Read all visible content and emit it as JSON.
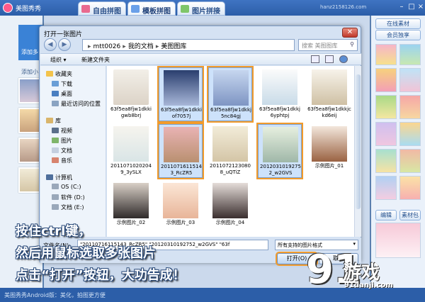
{
  "app": {
    "title": "美图秀秀",
    "url": "hanz2158126.com",
    "tabs": [
      "自由拼图",
      "模板拼图",
      "图片拼接"
    ]
  },
  "left_panel": {
    "add_background": "添加多",
    "add_image": "添加小"
  },
  "right_panel": {
    "online_material": "在线素材",
    "vip": "会员独享",
    "edit": "编辑",
    "material": "素材包"
  },
  "status_bar": "美图秀秀Android版：美化，拍图更方便",
  "dialog": {
    "title": "打开一张图片",
    "close": "✕",
    "address": [
      "mtt0026",
      "我的文档",
      "美图图库"
    ],
    "search_placeholder": "搜索 美图图库",
    "toolbar": {
      "organize": "组织",
      "new_folder": "新建文件夹"
    },
    "nav": {
      "favorites": "收藏夹",
      "download": "下载",
      "desktop": "桌面",
      "recent": "最近访问的位置",
      "libraries": "库",
      "video": "视频",
      "pictures": "图片",
      "documents": "文档",
      "music": "音乐",
      "computer": "计算机",
      "os_c": "OS (C:)",
      "soft_d": "软件 (D:)",
      "doc_e": "文档 (E:)"
    },
    "files": [
      {
        "name": "63f5ea8fjw1dkkigwb8brj",
        "selected": false,
        "highlight": false
      },
      {
        "name": "63f5ea8fjw1dkkiof7057j",
        "selected": true,
        "highlight": true
      },
      {
        "name": "63f5ea8fjw1dkkj5nc84gj",
        "selected": true,
        "highlight": true
      },
      {
        "name": "63f5ea8fjw1dkkj6yphtpj",
        "selected": false,
        "highlight": false
      },
      {
        "name": "63f5ea8fjw1dkkjckd6eij",
        "selected": false,
        "highlight": false
      },
      {
        "name": "20110710202049_3ySLX",
        "selected": false,
        "highlight": false
      },
      {
        "name": "20110716115143_RcZR5",
        "selected": true,
        "highlight": true
      },
      {
        "name": "20110721230808_uQTiZ",
        "selected": false,
        "highlight": false
      },
      {
        "name": "20120310192752_w2GVS",
        "selected": true,
        "highlight": true
      },
      {
        "name": "示例图片_01",
        "selected": false,
        "highlight": false
      },
      {
        "name": "示例图片_02",
        "selected": false,
        "highlight": false
      },
      {
        "name": "示例图片_03",
        "selected": false,
        "highlight": false
      },
      {
        "name": "示例图片_04",
        "selected": false,
        "highlight": false
      }
    ],
    "filename_label": "文件名(N):",
    "filename_value": "\"20110716115143_RcZR5\" \"20120310192752_w2GVS\" \"63f",
    "filetype": "所有支持的图片格式",
    "open_button": "打开(O)",
    "cancel_button": "取消"
  },
  "caption": {
    "line1": "按住ctrl键，",
    "line2": "然后用鼠标选取多张图片",
    "line3": "点击“打开”按钮，大功告成！"
  },
  "logo": {
    "number": "91",
    "text": "游戏",
    "url": "91danji.com"
  },
  "colors": {
    "highlight": "#f29b2b",
    "selection": "#cde2fb",
    "accent": "#2c5ea8"
  }
}
